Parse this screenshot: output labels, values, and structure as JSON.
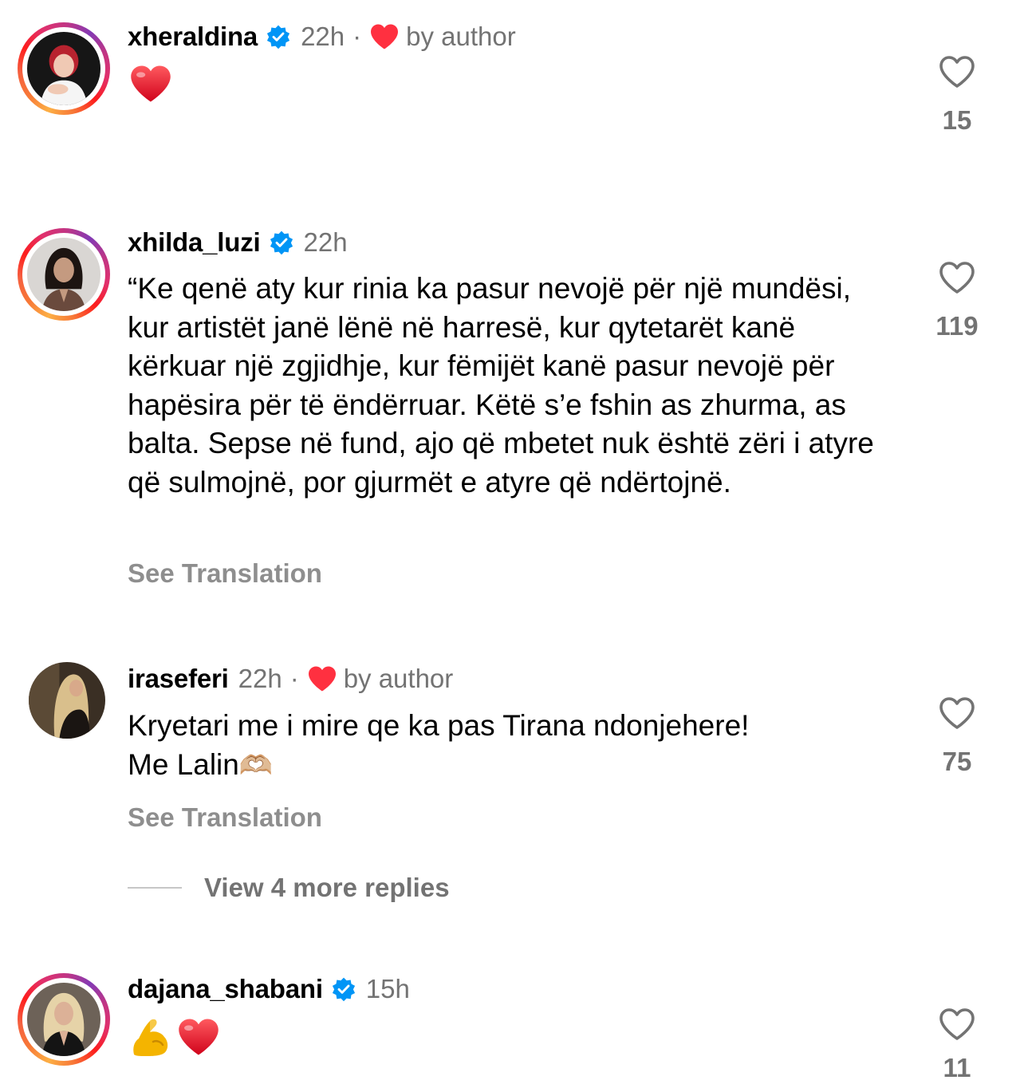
{
  "comments": [
    {
      "username": "xheraldina",
      "time": "22h",
      "liked_by_author": true,
      "by_author_label": "by author",
      "emoji": [
        "❤️"
      ],
      "likes": "15"
    },
    {
      "username": "xhilda_luzi",
      "time": "22h",
      "text": "“Ke qenë aty kur rinia ka pasur nevojë për një mundësi, kur artistët janë lënë në harresë, kur qytetarët kanë kërkuar një zgjidhje, kur fëmijët kanë pasur nevojë për hapësira për të ëndërruar. Këtë s’e fshin as zhurma, as balta. Sepse në fund, ajo që mbetet nuk është zëri i atyre që sulmojnë, por gjurmët e atyre që ndërtojnë.",
      "see_translation": "See Translation",
      "likes": "119"
    },
    {
      "username": "iraseferi",
      "time": "22h",
      "liked_by_author": true,
      "by_author_label": "by author",
      "text_line1": "Kryetari me i mire qe ka pas Tirana ndonjehere!",
      "text_line2": "Me Lalin",
      "text_emoji": "🫶🏼",
      "see_translation": "See Translation",
      "likes": "75"
    },
    {
      "username": "dajana_shabani",
      "time": "15h",
      "emoji": [
        "💪",
        "❤️"
      ],
      "likes": "11"
    }
  ],
  "view_replies": "View 4 more replies",
  "icons": {
    "verified": "verified-badge-icon",
    "like": "heart-outline-icon",
    "author_like": "heart-filled-icon"
  },
  "colors": {
    "verified_blue": "#0095f6",
    "author_heart": "#ff3040",
    "secondary_text": "#737373"
  }
}
